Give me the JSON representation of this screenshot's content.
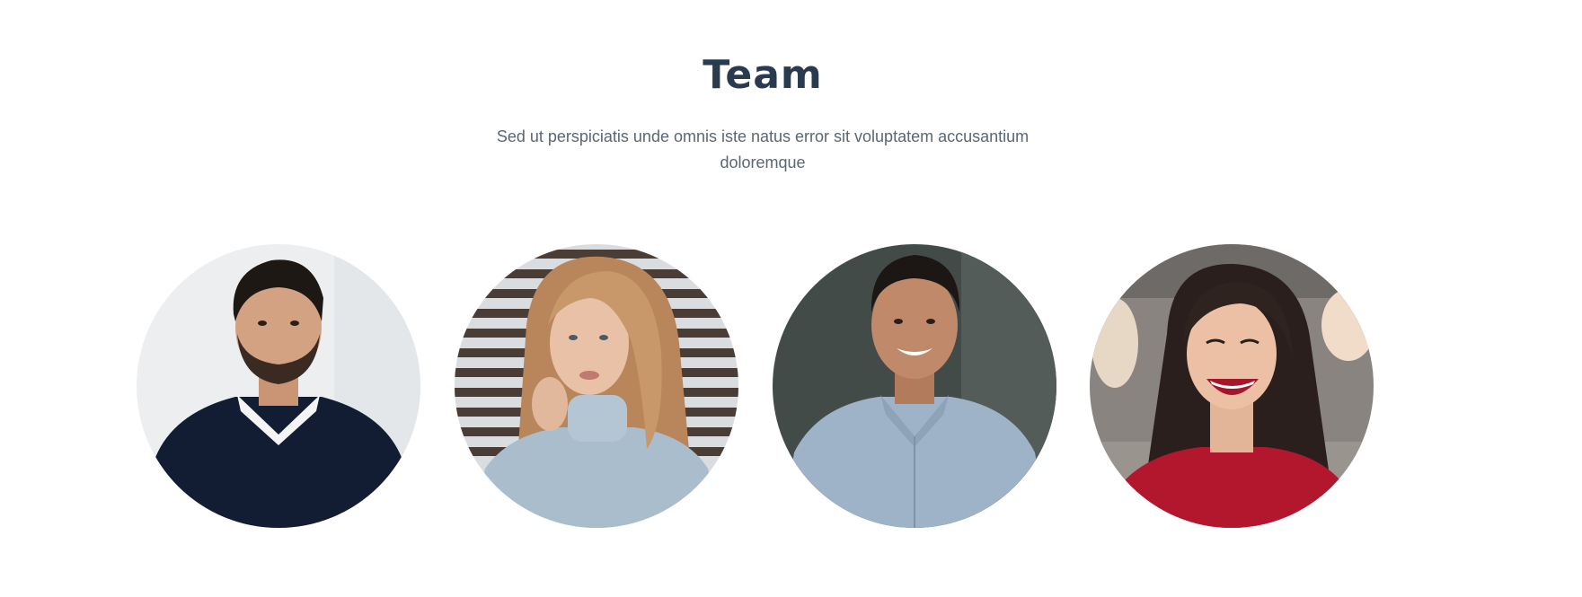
{
  "team": {
    "title": "Team",
    "subtitle": "Sed ut perspiciatis unde omnis iste natus error sit voluptatem accusantium doloremque",
    "members": [
      {
        "photo": "man-navy-sweater-portrait"
      },
      {
        "photo": "woman-grey-turtleneck-portrait"
      },
      {
        "photo": "man-blue-shirt-portrait"
      },
      {
        "photo": "woman-red-top-laughing-portrait"
      }
    ]
  },
  "colors": {
    "title": "#2a3b4f",
    "subtitle": "#5c6674",
    "background": "#ffffff"
  }
}
